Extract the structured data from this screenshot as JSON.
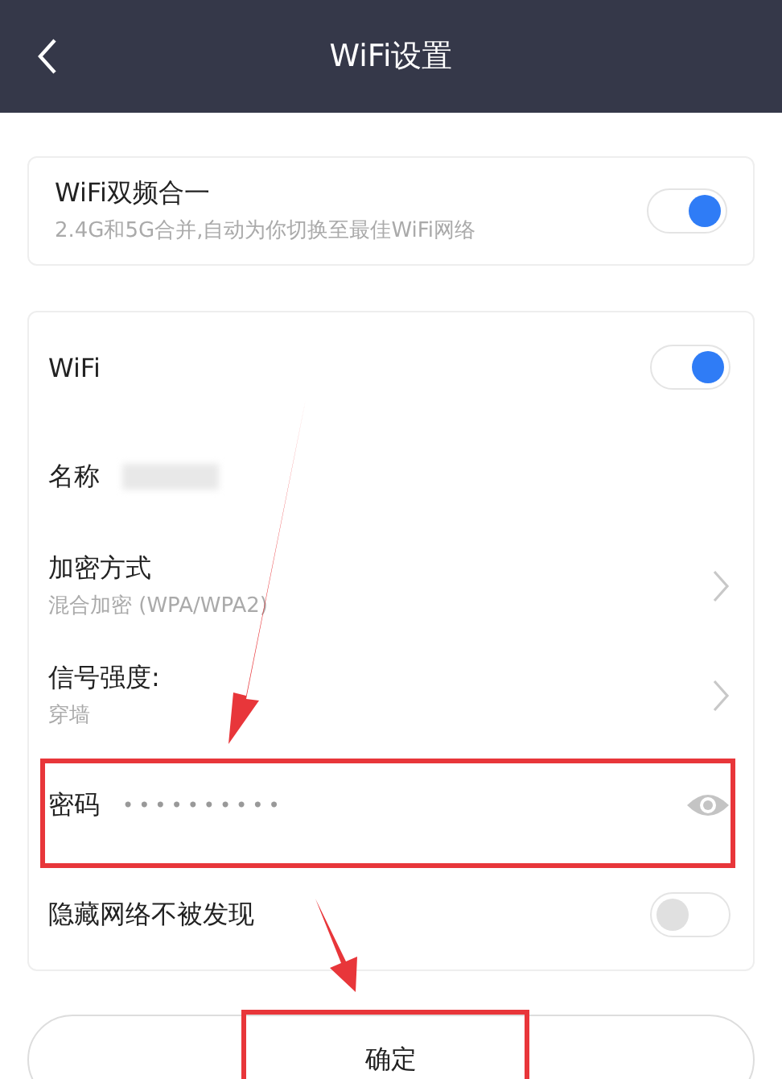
{
  "header": {
    "title": "WiFi设置"
  },
  "dual_band": {
    "title": "WiFi双频合一",
    "subtitle": "2.4G和5G合并,自动为你切换至最佳WiFi网络",
    "on": true
  },
  "rows": [
    {
      "kind": "toggle",
      "label": "WiFi",
      "on": true
    },
    {
      "kind": "name",
      "label": "名称"
    },
    {
      "kind": "chevron",
      "label": "加密方式",
      "subtitle": "混合加密 (WPA/WPA2)"
    },
    {
      "kind": "chevron",
      "label": "信号强度:",
      "subtitle": "穿墙"
    },
    {
      "kind": "password",
      "label": "密码",
      "value": "••••••••••",
      "highlighted": true
    },
    {
      "kind": "toggle",
      "label": "隐藏网络不被发现",
      "on": false
    }
  ],
  "confirm_button": {
    "label": "确定",
    "highlighted": true
  }
}
